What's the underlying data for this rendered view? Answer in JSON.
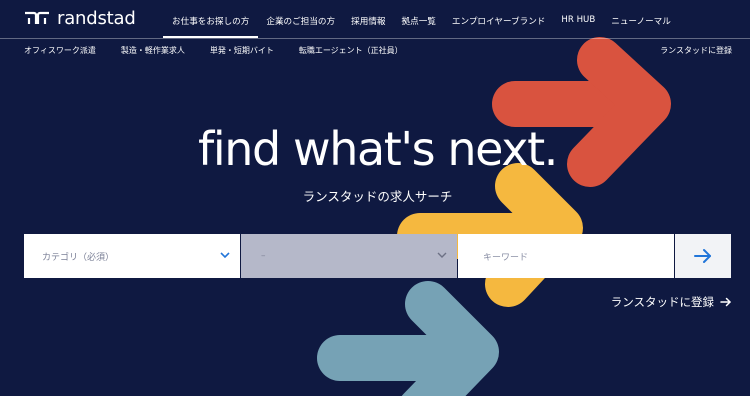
{
  "brand": {
    "name": "randstad",
    "logo_icon": "randstad-logo-icon"
  },
  "main_nav": [
    {
      "label": "お仕事をお探しの方",
      "active": true
    },
    {
      "label": "企業のご担当の方"
    },
    {
      "label": "採用情報"
    },
    {
      "label": "拠点一覧"
    },
    {
      "label": "エンプロイヤーブランド"
    },
    {
      "label": "HR HUB"
    },
    {
      "label": "ニューノーマル"
    }
  ],
  "sub_nav": [
    {
      "label": "オフィスワーク派遣"
    },
    {
      "label": "製造・軽作業求人"
    },
    {
      "label": "単発・短期バイト"
    },
    {
      "label": "転職エージェント（正社員）"
    }
  ],
  "sub_nav_register": "ランスタッドに登録",
  "hero": {
    "title": "find what's next.",
    "subtitle": "ランスタッドの求人サーチ"
  },
  "search": {
    "category_placeholder": "カテゴリ（必須）",
    "subcategory_placeholder": "–",
    "keyword_placeholder": "キーワード",
    "submit_icon": "arrow-right-icon"
  },
  "cta": {
    "label": "ランスタッドに登録",
    "icon": "arrow-right-icon"
  },
  "colors": {
    "background": "#0f1941",
    "arrow_red": "#d9533f",
    "arrow_yellow": "#f5b83f",
    "arrow_blue": "#76a2b5",
    "accent_blue": "#2175d9"
  }
}
